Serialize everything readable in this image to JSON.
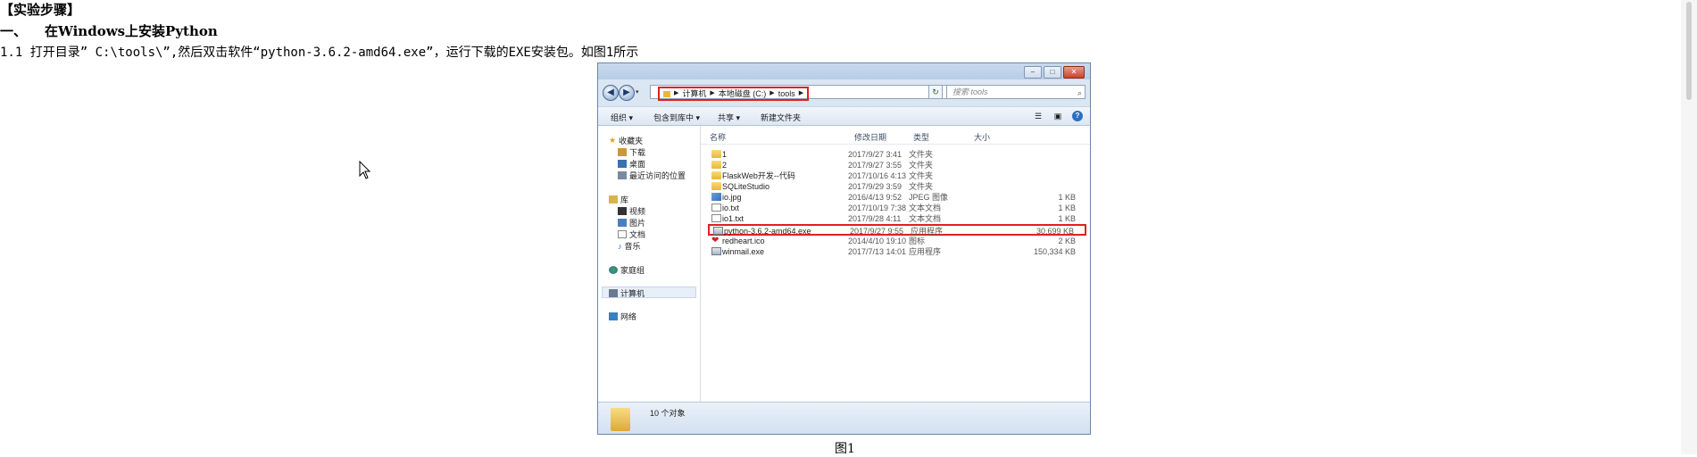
{
  "document": {
    "heading": "【实验步骤】",
    "section_num": "一、",
    "section_title": "在Windows上安装Python",
    "step": "1.1 打开目录” C:\\tools\\”,然后双击软件“python-3.6.2-amd64.exe”，运行下载的EXE安装包。如图1所示",
    "caption": "图1"
  },
  "explorer": {
    "breadcrumbs": [
      "计算机",
      "本地磁盘 (C:)",
      "tools"
    ],
    "search_placeholder": "搜索 tools",
    "toolbar": [
      "组织 ▾",
      "包含到库中 ▾",
      "共享 ▾",
      "新建文件夹"
    ],
    "nav": {
      "favorites": "收藏夹",
      "downloads": "下载",
      "desktop": "桌面",
      "recent": "最近访问的位置",
      "libraries": "库",
      "videos": "视频",
      "pictures": "图片",
      "documents": "文档",
      "music": "音乐",
      "homegroup": "家庭组",
      "computer": "计算机",
      "network": "网络"
    },
    "columns": {
      "name": "名称",
      "date": "修改日期",
      "type": "类型",
      "size": "大小"
    },
    "files": [
      {
        "name": "1",
        "date": "2017/9/27 3:41",
        "type": "文件夹",
        "size": ""
      },
      {
        "name": "2",
        "date": "2017/9/27 3:55",
        "type": "文件夹",
        "size": ""
      },
      {
        "name": "FlaskWeb开发--代码",
        "date": "2017/10/16 4:13",
        "type": "文件夹",
        "size": ""
      },
      {
        "name": "SQLiteStudio",
        "date": "2017/9/29 3:59",
        "type": "文件夹",
        "size": ""
      },
      {
        "name": "io.jpg",
        "date": "2016/4/13 9:52",
        "type": "JPEG 图像",
        "size": "1 KB"
      },
      {
        "name": "io.txt",
        "date": "2017/10/19 7:38",
        "type": "文本文档",
        "size": "1 KB"
      },
      {
        "name": "io1.txt",
        "date": "2017/9/28 4:11",
        "type": "文本文档",
        "size": "1 KB"
      },
      {
        "name": "python-3.6.2-amd64.exe",
        "date": "2017/9/27 9:55",
        "type": "应用程序",
        "size": "30,699 KB"
      },
      {
        "name": "redheart.ico",
        "date": "2014/4/10 19:10",
        "type": "图标",
        "size": "2 KB"
      },
      {
        "name": "winmail.exe",
        "date": "2017/7/13 14:01",
        "type": "应用程序",
        "size": "150,334 KB"
      }
    ],
    "status": "10 个对象"
  }
}
